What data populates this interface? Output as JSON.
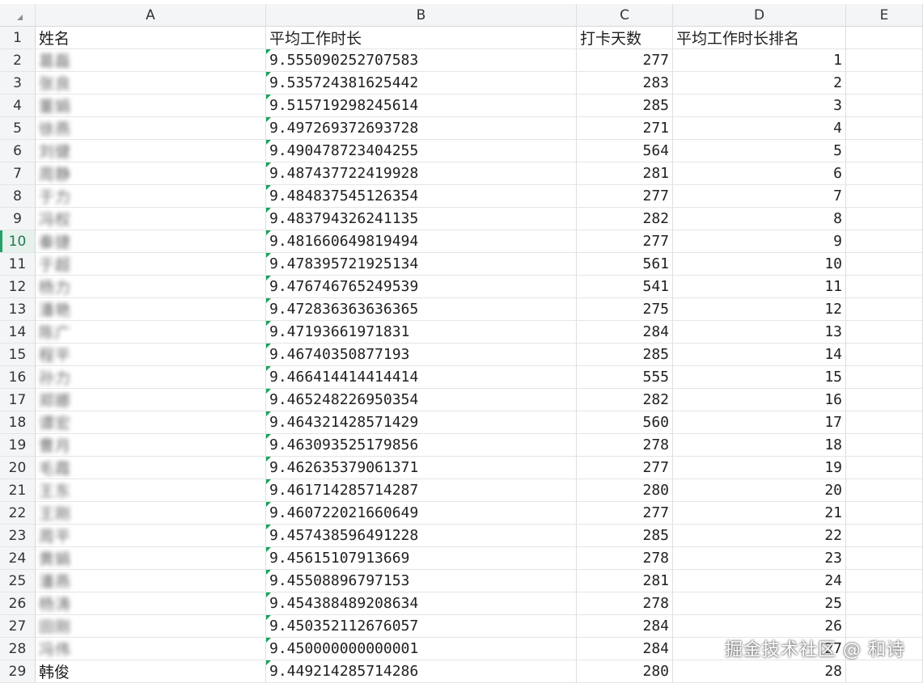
{
  "columns": [
    "A",
    "B",
    "C",
    "D",
    "E"
  ],
  "header_row": {
    "num": "1",
    "a": "姓名",
    "b": "平均工作时长",
    "c": "打卡天数",
    "d": "平均工作时长排名",
    "e": ""
  },
  "rows": [
    {
      "num": "2",
      "name": "葛磊",
      "avg": "9.555090252707583",
      "days": "277",
      "rank": "1"
    },
    {
      "num": "3",
      "name": "张良",
      "avg": "9.535724381625442",
      "days": "283",
      "rank": "2"
    },
    {
      "num": "4",
      "name": "董娟",
      "avg": "9.515719298245614",
      "days": "285",
      "rank": "3"
    },
    {
      "num": "5",
      "name": "徐燕",
      "avg": "9.497269372693728",
      "days": "271",
      "rank": "4"
    },
    {
      "num": "6",
      "name": "刘健",
      "avg": "9.490478723404255",
      "days": "564",
      "rank": "5"
    },
    {
      "num": "7",
      "name": "周静",
      "avg": "9.487437722419928",
      "days": "281",
      "rank": "6"
    },
    {
      "num": "8",
      "name": "于力",
      "avg": "9.484837545126354",
      "days": "277",
      "rank": "7"
    },
    {
      "num": "9",
      "name": "冯权",
      "avg": "9.483794326241135",
      "days": "282",
      "rank": "8"
    },
    {
      "num": "10",
      "name": "秦捷",
      "avg": "9.481660649819494",
      "days": "277",
      "rank": "9"
    },
    {
      "num": "11",
      "name": "于超",
      "avg": "9.478395721925134",
      "days": "561",
      "rank": "10"
    },
    {
      "num": "12",
      "name": "杨力",
      "avg": "9.476746765249539",
      "days": "541",
      "rank": "11"
    },
    {
      "num": "13",
      "name": "潘艳",
      "avg": "9.472836363636365",
      "days": "275",
      "rank": "12"
    },
    {
      "num": "14",
      "name": "陈广",
      "avg": "9.47193661971831",
      "days": "284",
      "rank": "13"
    },
    {
      "num": "15",
      "name": "程平",
      "avg": "9.46740350877193",
      "days": "285",
      "rank": "14"
    },
    {
      "num": "16",
      "name": "孙力",
      "avg": "9.466414414414414",
      "days": "555",
      "rank": "15"
    },
    {
      "num": "17",
      "name": "郑娜",
      "avg": "9.465248226950354",
      "days": "282",
      "rank": "16"
    },
    {
      "num": "18",
      "name": "谭宏",
      "avg": "9.464321428571429",
      "days": "560",
      "rank": "17"
    },
    {
      "num": "19",
      "name": "曹月",
      "avg": "9.463093525179856",
      "days": "278",
      "rank": "18"
    },
    {
      "num": "20",
      "name": "毛霞",
      "avg": "9.462635379061371",
      "days": "277",
      "rank": "19"
    },
    {
      "num": "21",
      "name": "王东",
      "avg": "9.461714285714287",
      "days": "280",
      "rank": "20"
    },
    {
      "num": "22",
      "name": "王刚",
      "avg": "9.460722021660649",
      "days": "277",
      "rank": "21"
    },
    {
      "num": "23",
      "name": "周平",
      "avg": "9.457438596491228",
      "days": "285",
      "rank": "22"
    },
    {
      "num": "24",
      "name": "黄娟",
      "avg": "9.45615107913669",
      "days": "278",
      "rank": "23"
    },
    {
      "num": "25",
      "name": "潘燕",
      "avg": "9.45508896797153",
      "days": "281",
      "rank": "24"
    },
    {
      "num": "26",
      "name": "杨涛",
      "avg": "9.454388489208634",
      "days": "278",
      "rank": "25"
    },
    {
      "num": "27",
      "name": "田刚",
      "avg": "9.450352112676057",
      "days": "284",
      "rank": "26"
    },
    {
      "num": "28",
      "name": "冯伟",
      "avg": "9.450000000000001",
      "days": "284",
      "rank": "27"
    },
    {
      "num": "29",
      "name": "韩俊",
      "avg": "9.449214285714286",
      "days": "280",
      "rank": "28"
    }
  ],
  "active_row": "10",
  "watermark": "掘金技术社区 @ 和诗",
  "colors": {
    "accent": "#21a366",
    "flag": "#1aa15a",
    "header_bg": "#f4f5f7",
    "grid": "#e3e5e8"
  }
}
